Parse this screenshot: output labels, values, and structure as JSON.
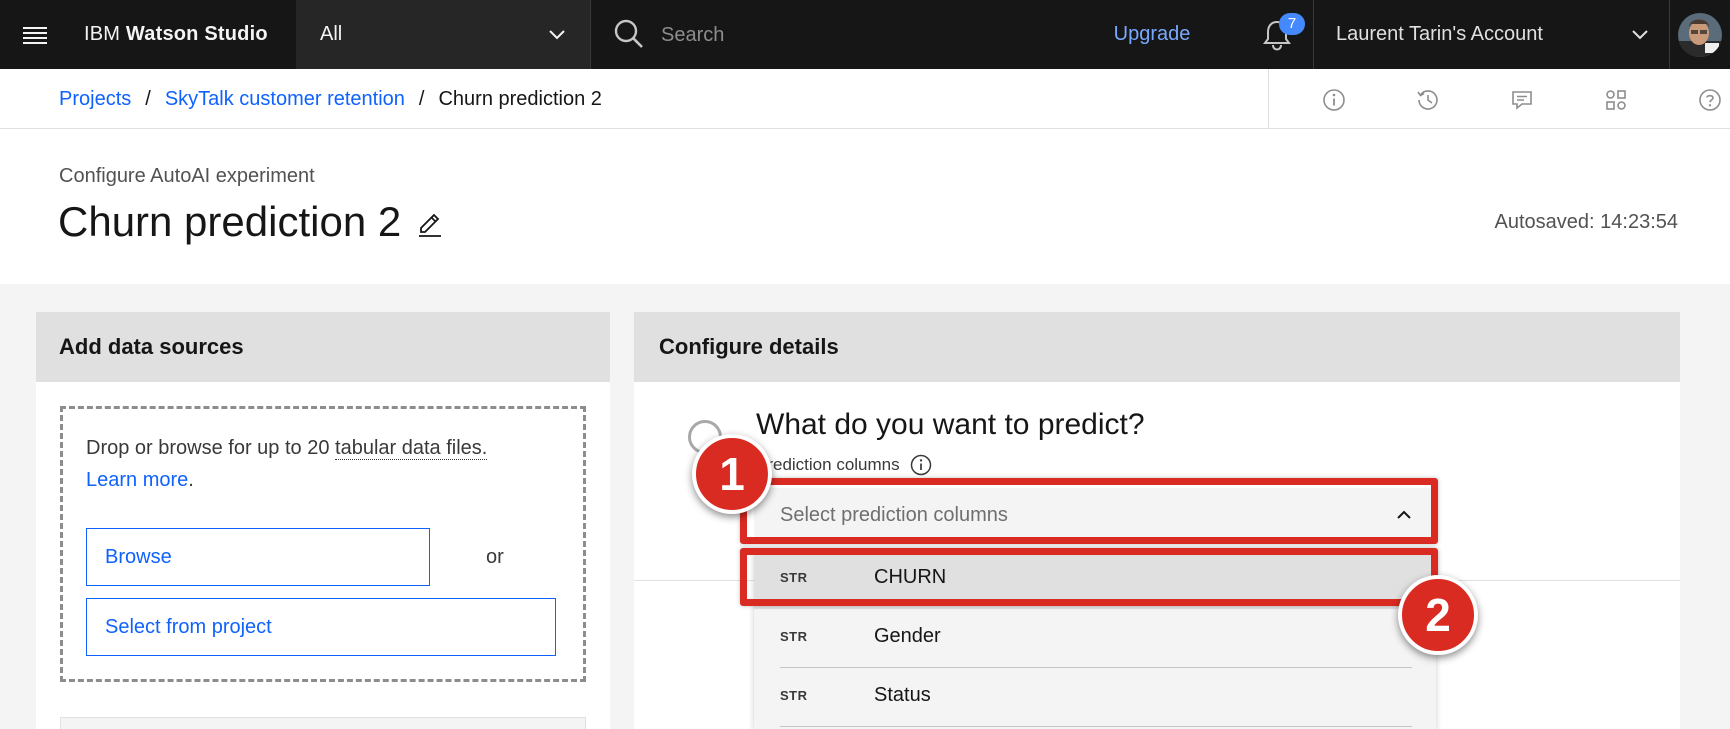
{
  "topbar": {
    "brand_prefix": "IBM ",
    "brand_name": "Watson Studio",
    "scope_value": "All",
    "search_placeholder": "Search",
    "upgrade_label": "Upgrade",
    "notification_count": "7",
    "account_label": "Laurent Tarin's Account"
  },
  "breadcrumb": {
    "items": [
      "Projects",
      "SkyTalk customer retention"
    ],
    "separator": "/",
    "current": "Churn prediction 2"
  },
  "utilities": [
    "info-icon",
    "history-icon",
    "comments-icon",
    "apps-icon",
    "help-icon"
  ],
  "header": {
    "kicker": "Configure AutoAI experiment",
    "title": "Churn prediction 2",
    "autosaved": "Autosaved: 14:23:54"
  },
  "data_sources": {
    "heading": "Add data sources",
    "drop_text_prefix": "Drop or browse for up to 20 ",
    "drop_text_link": "tabular data files.",
    "learn_more": "Learn more",
    "learn_more_suffix": ".",
    "browse_label": "Browse",
    "or_label": "or",
    "select_project_label": "Select from project"
  },
  "details": {
    "heading": "Configure details",
    "question": "What do you want to predict?",
    "prediction_label": "Prediction columns",
    "select_placeholder": "Select prediction columns",
    "options": [
      {
        "type": "STR",
        "name": "CHURN"
      },
      {
        "type": "STR",
        "name": "Gender"
      },
      {
        "type": "STR",
        "name": "Status"
      }
    ]
  },
  "annotations": {
    "callout_1": "1",
    "callout_2": "2",
    "color": "#d92b22"
  },
  "colors": {
    "topbar_bg": "#161616",
    "link_blue": "#0f62fe",
    "upgrade_blue": "#78a9ff",
    "badge_blue": "#4589ff"
  }
}
